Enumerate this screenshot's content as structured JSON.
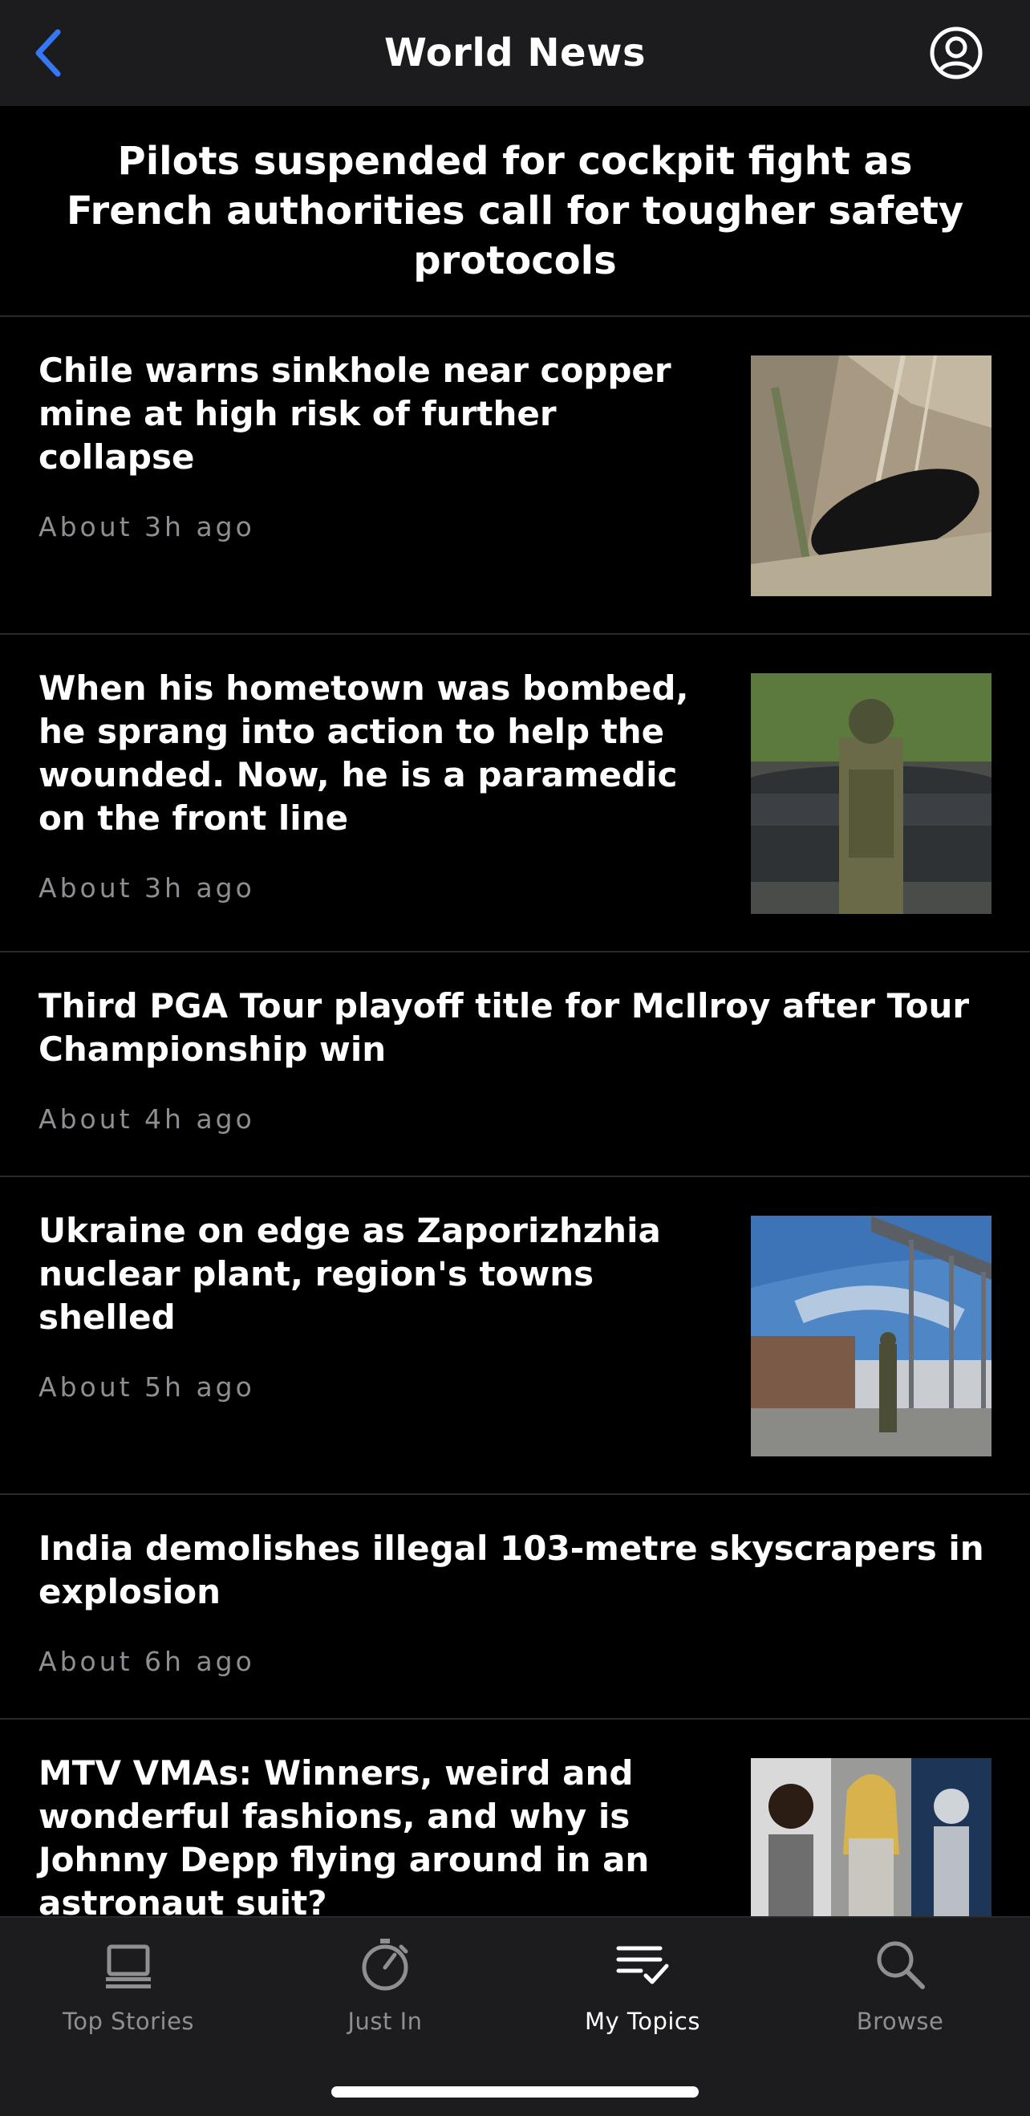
{
  "nav": {
    "title": "World News",
    "back_icon": "chevron-left-icon",
    "profile_icon": "person-circle-icon"
  },
  "headline": "Pilots suspended for cockpit fight as French authorities call for tougher safety protocols",
  "stories": [
    {
      "title": "Chile warns sinkhole near copper mine at high risk of further collapse",
      "time": "About 3h ago",
      "thumb": "sinkhole-aerial-photo"
    },
    {
      "title": "When his hometown was bombed, he sprang into action to help the wounded. Now, he is a paramedic on the front line",
      "time": "About 3h ago",
      "thumb": "soldier-by-car-photo"
    },
    {
      "title": "Third PGA Tour playoff title for McIlroy after Tour Championship win",
      "time": "About 4h ago",
      "thumb": null
    },
    {
      "title": "Ukraine on edge as Zaporizhzhia nuclear plant, region's towns shelled",
      "time": "About 5h ago",
      "thumb": "nuclear-plant-soldier-photo"
    },
    {
      "title": "India demolishes illegal 103-metre skyscrapers in explosion",
      "time": "About 6h ago",
      "thumb": null
    },
    {
      "title": "MTV VMAs: Winners, weird and wonderful fashions, and why is Johnny Depp flying around in an astronaut suit?",
      "time": "",
      "thumb": "vma-celebrities-photo"
    }
  ],
  "tabs": [
    {
      "label": "Top Stories",
      "icon": "laptop-icon"
    },
    {
      "label": "Just In",
      "icon": "stopwatch-icon"
    },
    {
      "label": "My Topics",
      "icon": "checklist-icon",
      "active": true
    },
    {
      "label": "Browse",
      "icon": "search-icon"
    }
  ],
  "colors": {
    "accent": "#3478f6",
    "background": "#000000",
    "bar": "#1c1c1e",
    "secondary_text": "#8e8e93"
  }
}
